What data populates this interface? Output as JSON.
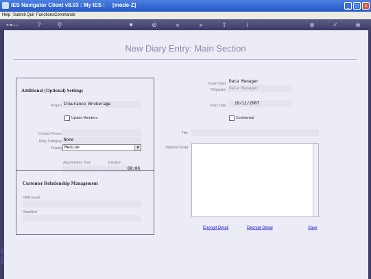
{
  "window": {
    "title": "IES Navigator Client v8.03 : My IES :     [mode-Z]",
    "min": "_",
    "max": "□",
    "close": "×"
  },
  "menu": [
    "Help",
    "Submit",
    "Quit",
    "Functions",
    "Commands"
  ],
  "page_title": "New Diary Entry: Main Section",
  "left_panel": {
    "heading": "Additional (Optional) Settings",
    "project_label": "Project",
    "project_value": "Insurance Brokerage",
    "update_members_label": "Update Members",
    "contact_person_label": "Contact Person",
    "diary_category_label": "Diary Category",
    "diary_category_value": "None",
    "priority_label": "Priority",
    "priority_value": "Medium",
    "appointment_time_label": "Appointment Time",
    "duration_label": "Duration",
    "duration_value": "00:00",
    "crm_heading": "Customer Relationship Management",
    "crm_event_label": "CRM Event",
    "dataalert_label": "DataAlert"
  },
  "right": {
    "target_diary_label": "Target Diary",
    "target_diary_value": "Data Manager",
    "originator_label": "*Originator",
    "originator_value": "Data Manager",
    "diary_date_label": "Diary Date",
    "diary_date_value": "19/11/2007",
    "confidential_label": "Confidential",
    "title_label": "Title",
    "optional_detail_label": "Optional Detail"
  },
  "actions": {
    "encrypt": "Encrypt Detail",
    "decrypt": "Decrypt Detail",
    "save": "Save"
  },
  "colors": {
    "title_bar": "#2a5fd0",
    "toolbar": "#4a4a74",
    "content_bg": "#ececf6",
    "link": "#2222cc"
  }
}
